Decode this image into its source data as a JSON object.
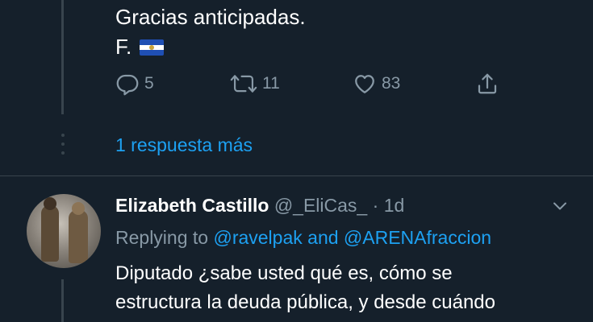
{
  "upper_tweet": {
    "text_line": "Gracias anticipadas.",
    "signature": "F.",
    "flag_icon": "el-salvador-flag",
    "actions": {
      "reply_count": "5",
      "retweet_count": "11",
      "like_count": "83"
    }
  },
  "show_more": {
    "label": "1 respuesta más"
  },
  "reply_tweet": {
    "display_name": "Elizabeth Castillo",
    "handle": "@_EliCas_",
    "separator": "·",
    "time": "1d",
    "replying_prefix": "Replying to",
    "mention_1": "@ravelpak",
    "joiner": "and",
    "mention_2": "@ARENAfraccion",
    "body_lines": [
      "Diputado ¿sabe usted qué es, cómo se",
      "estructura la deuda pública, y desde cuándo"
    ]
  },
  "colors": {
    "background": "#15202b",
    "secondary_text": "#8899a6",
    "accent": "#1da1f2",
    "divider": "#38444d"
  }
}
